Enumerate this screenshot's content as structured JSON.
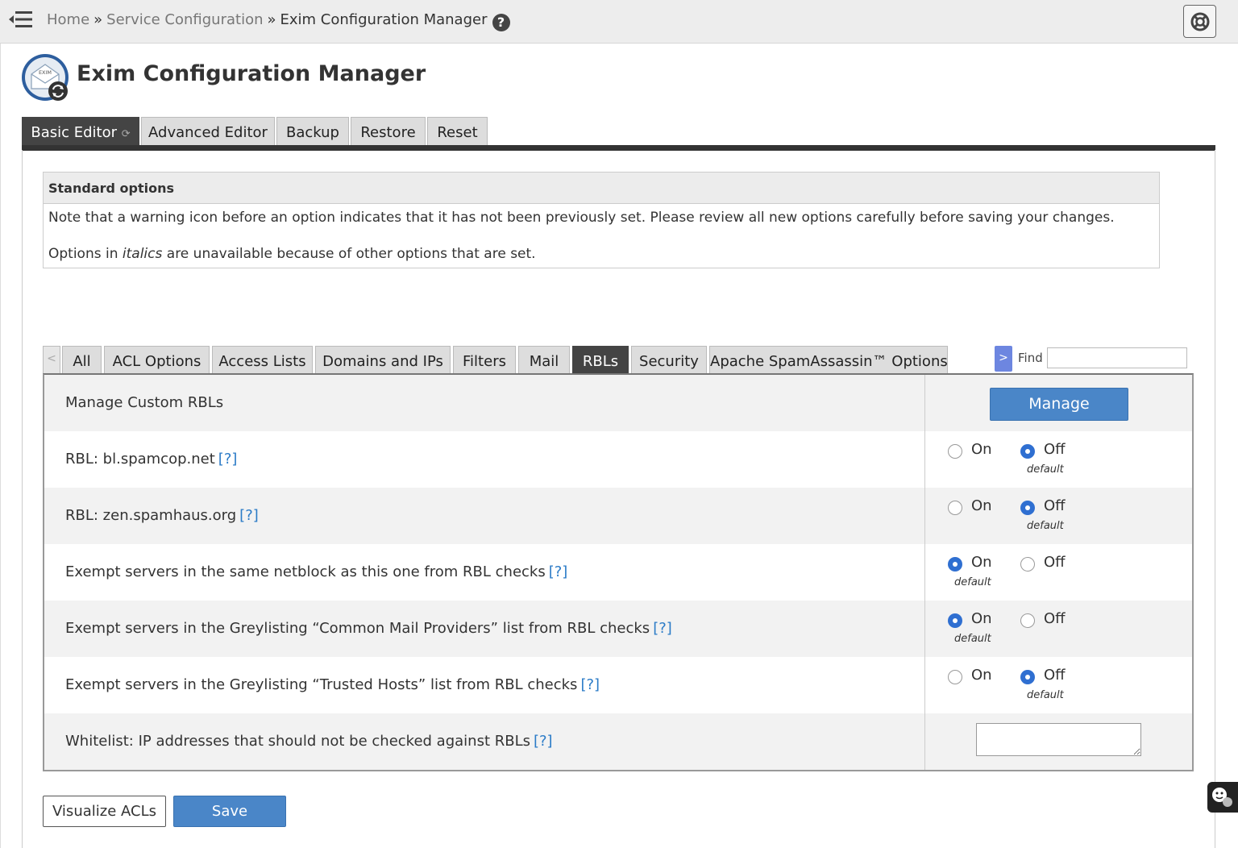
{
  "breadcrumb": {
    "home": "Home",
    "sep": "»",
    "service": "Service Configuration",
    "current": "Exim Configuration Manager",
    "help": "?"
  },
  "page": {
    "title": "Exim Configuration Manager",
    "logo_text": "EXIM"
  },
  "main_tabs": [
    {
      "label": "Basic Editor",
      "active": true
    },
    {
      "label": "Advanced Editor",
      "active": false
    },
    {
      "label": "Backup",
      "active": false
    },
    {
      "label": "Restore",
      "active": false
    },
    {
      "label": "Reset",
      "active": false
    }
  ],
  "standard_options": {
    "heading": "Standard options",
    "note": "Note that a warning icon before an option indicates that it has not been previously set. Please review all new options carefully before saving your changes.",
    "italics_prefix": "Options in ",
    "italics_word": "italics",
    "italics_suffix": " are unavailable because of other options that are set."
  },
  "sub_tabs": {
    "prev": "<",
    "next": ">",
    "items": [
      "All",
      "ACL Options",
      "Access Lists",
      "Domains and IPs",
      "Filters",
      "Mail",
      "RBLs",
      "Security",
      "Apache SpamAssassin™ Options"
    ],
    "active": "RBLs"
  },
  "find": {
    "label": "Find",
    "value": ""
  },
  "rows": [
    {
      "label": "Manage Custom RBLs",
      "help": "",
      "control": "button",
      "button_label": "Manage"
    },
    {
      "label": "RBL: bl.spamcop.net",
      "help": "[?]",
      "control": "radio",
      "selected": "Off",
      "default": "Off"
    },
    {
      "label": "RBL: zen.spamhaus.org",
      "help": "[?]",
      "control": "radio",
      "selected": "Off",
      "default": "Off"
    },
    {
      "label": "Exempt servers in the same netblock as this one from RBL checks",
      "help": "[?]",
      "control": "radio",
      "selected": "On",
      "default": "On"
    },
    {
      "label": "Exempt servers in the Greylisting “Common Mail Providers” list from RBL checks",
      "help": "[?]",
      "control": "radio",
      "selected": "On",
      "default": "On"
    },
    {
      "label": "Exempt servers in the Greylisting “Trusted Hosts” list from RBL checks",
      "help": "[?]",
      "control": "radio",
      "selected": "Off",
      "default": "Off"
    },
    {
      "label": "Whitelist: IP addresses that should not be checked against RBLs",
      "help": "[?]",
      "control": "textarea",
      "value": ""
    }
  ],
  "radio_labels": {
    "on": "On",
    "off": "Off",
    "default": "default"
  },
  "footer": {
    "visualize": "Visualize ACLs",
    "save": "Save"
  },
  "colors": {
    "primary_button": "#4a86c8",
    "active_tab": "#444444",
    "radio_checked": "#2f6fd1",
    "help_link": "#2b7bc7"
  }
}
